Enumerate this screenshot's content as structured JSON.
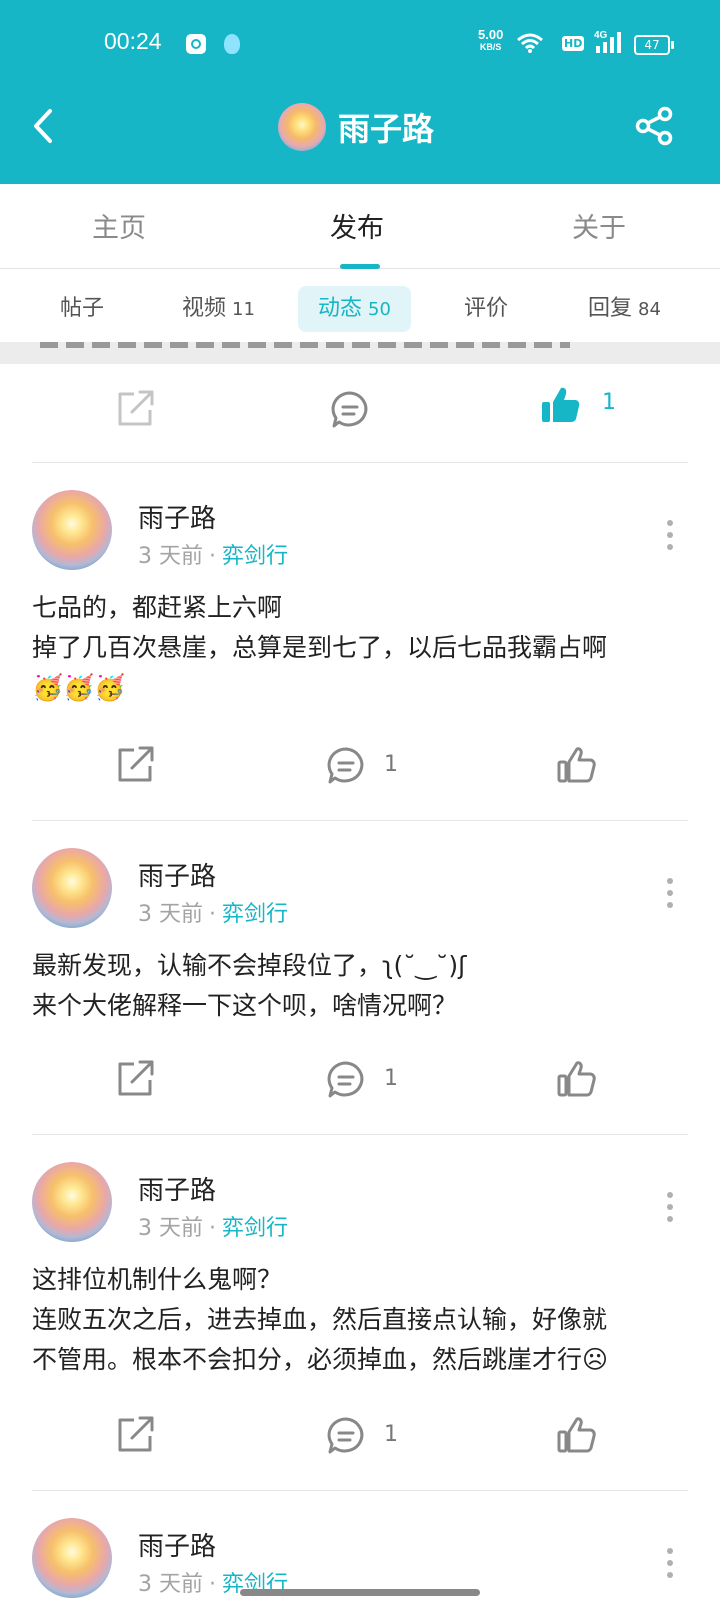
{
  "status_bar": {
    "time": "00:24",
    "speed_value": "5.00",
    "speed_unit": "KB/S",
    "hd": "HD",
    "network": "4G",
    "battery": "47"
  },
  "header": {
    "title": "雨子路",
    "accent_color": "#17b6c7"
  },
  "tabs": [
    {
      "label": "主页"
    },
    {
      "label": "发布"
    },
    {
      "label": "关于"
    }
  ],
  "active_tab": "发布",
  "subtabs": [
    {
      "label": "帖子",
      "count": ""
    },
    {
      "label": "视频",
      "count": "11"
    },
    {
      "label": "动态",
      "count": "50"
    },
    {
      "label": "评价",
      "count": ""
    },
    {
      "label": "回复",
      "count": "84"
    }
  ],
  "active_subtab": "动态",
  "top_actions": {
    "like_count": "1"
  },
  "posts": [
    {
      "author": "雨子路",
      "time": "3 天前",
      "separator": "·",
      "game": "弈剑行",
      "lines": [
        "七品的，都赶紧上六啊",
        "掉了几百次悬崖，总算是到七了，以后七品我霸占啊",
        "🥳🥳🥳"
      ],
      "comment_count": "1"
    },
    {
      "author": "雨子路",
      "time": "3 天前",
      "separator": "·",
      "game": "弈剑行",
      "lines": [
        "最新发现，认输不会掉段位了，ʅ(˘‿˘)ʃ",
        "来个大佬解释一下这个呗，啥情况啊？"
      ],
      "comment_count": "1"
    },
    {
      "author": "雨子路",
      "time": "3 天前",
      "separator": "·",
      "game": "弈剑行",
      "lines": [
        "这排位机制什么鬼啊？",
        "连败五次之后，进去掉血，然后直接点认输，好像就",
        "不管用。根本不会扣分，必须掉血，然后跳崖才行☹"
      ],
      "comment_count": "1"
    },
    {
      "author": "雨子路",
      "time": "3 天前",
      "separator": "·",
      "game": "弈剑行"
    }
  ]
}
